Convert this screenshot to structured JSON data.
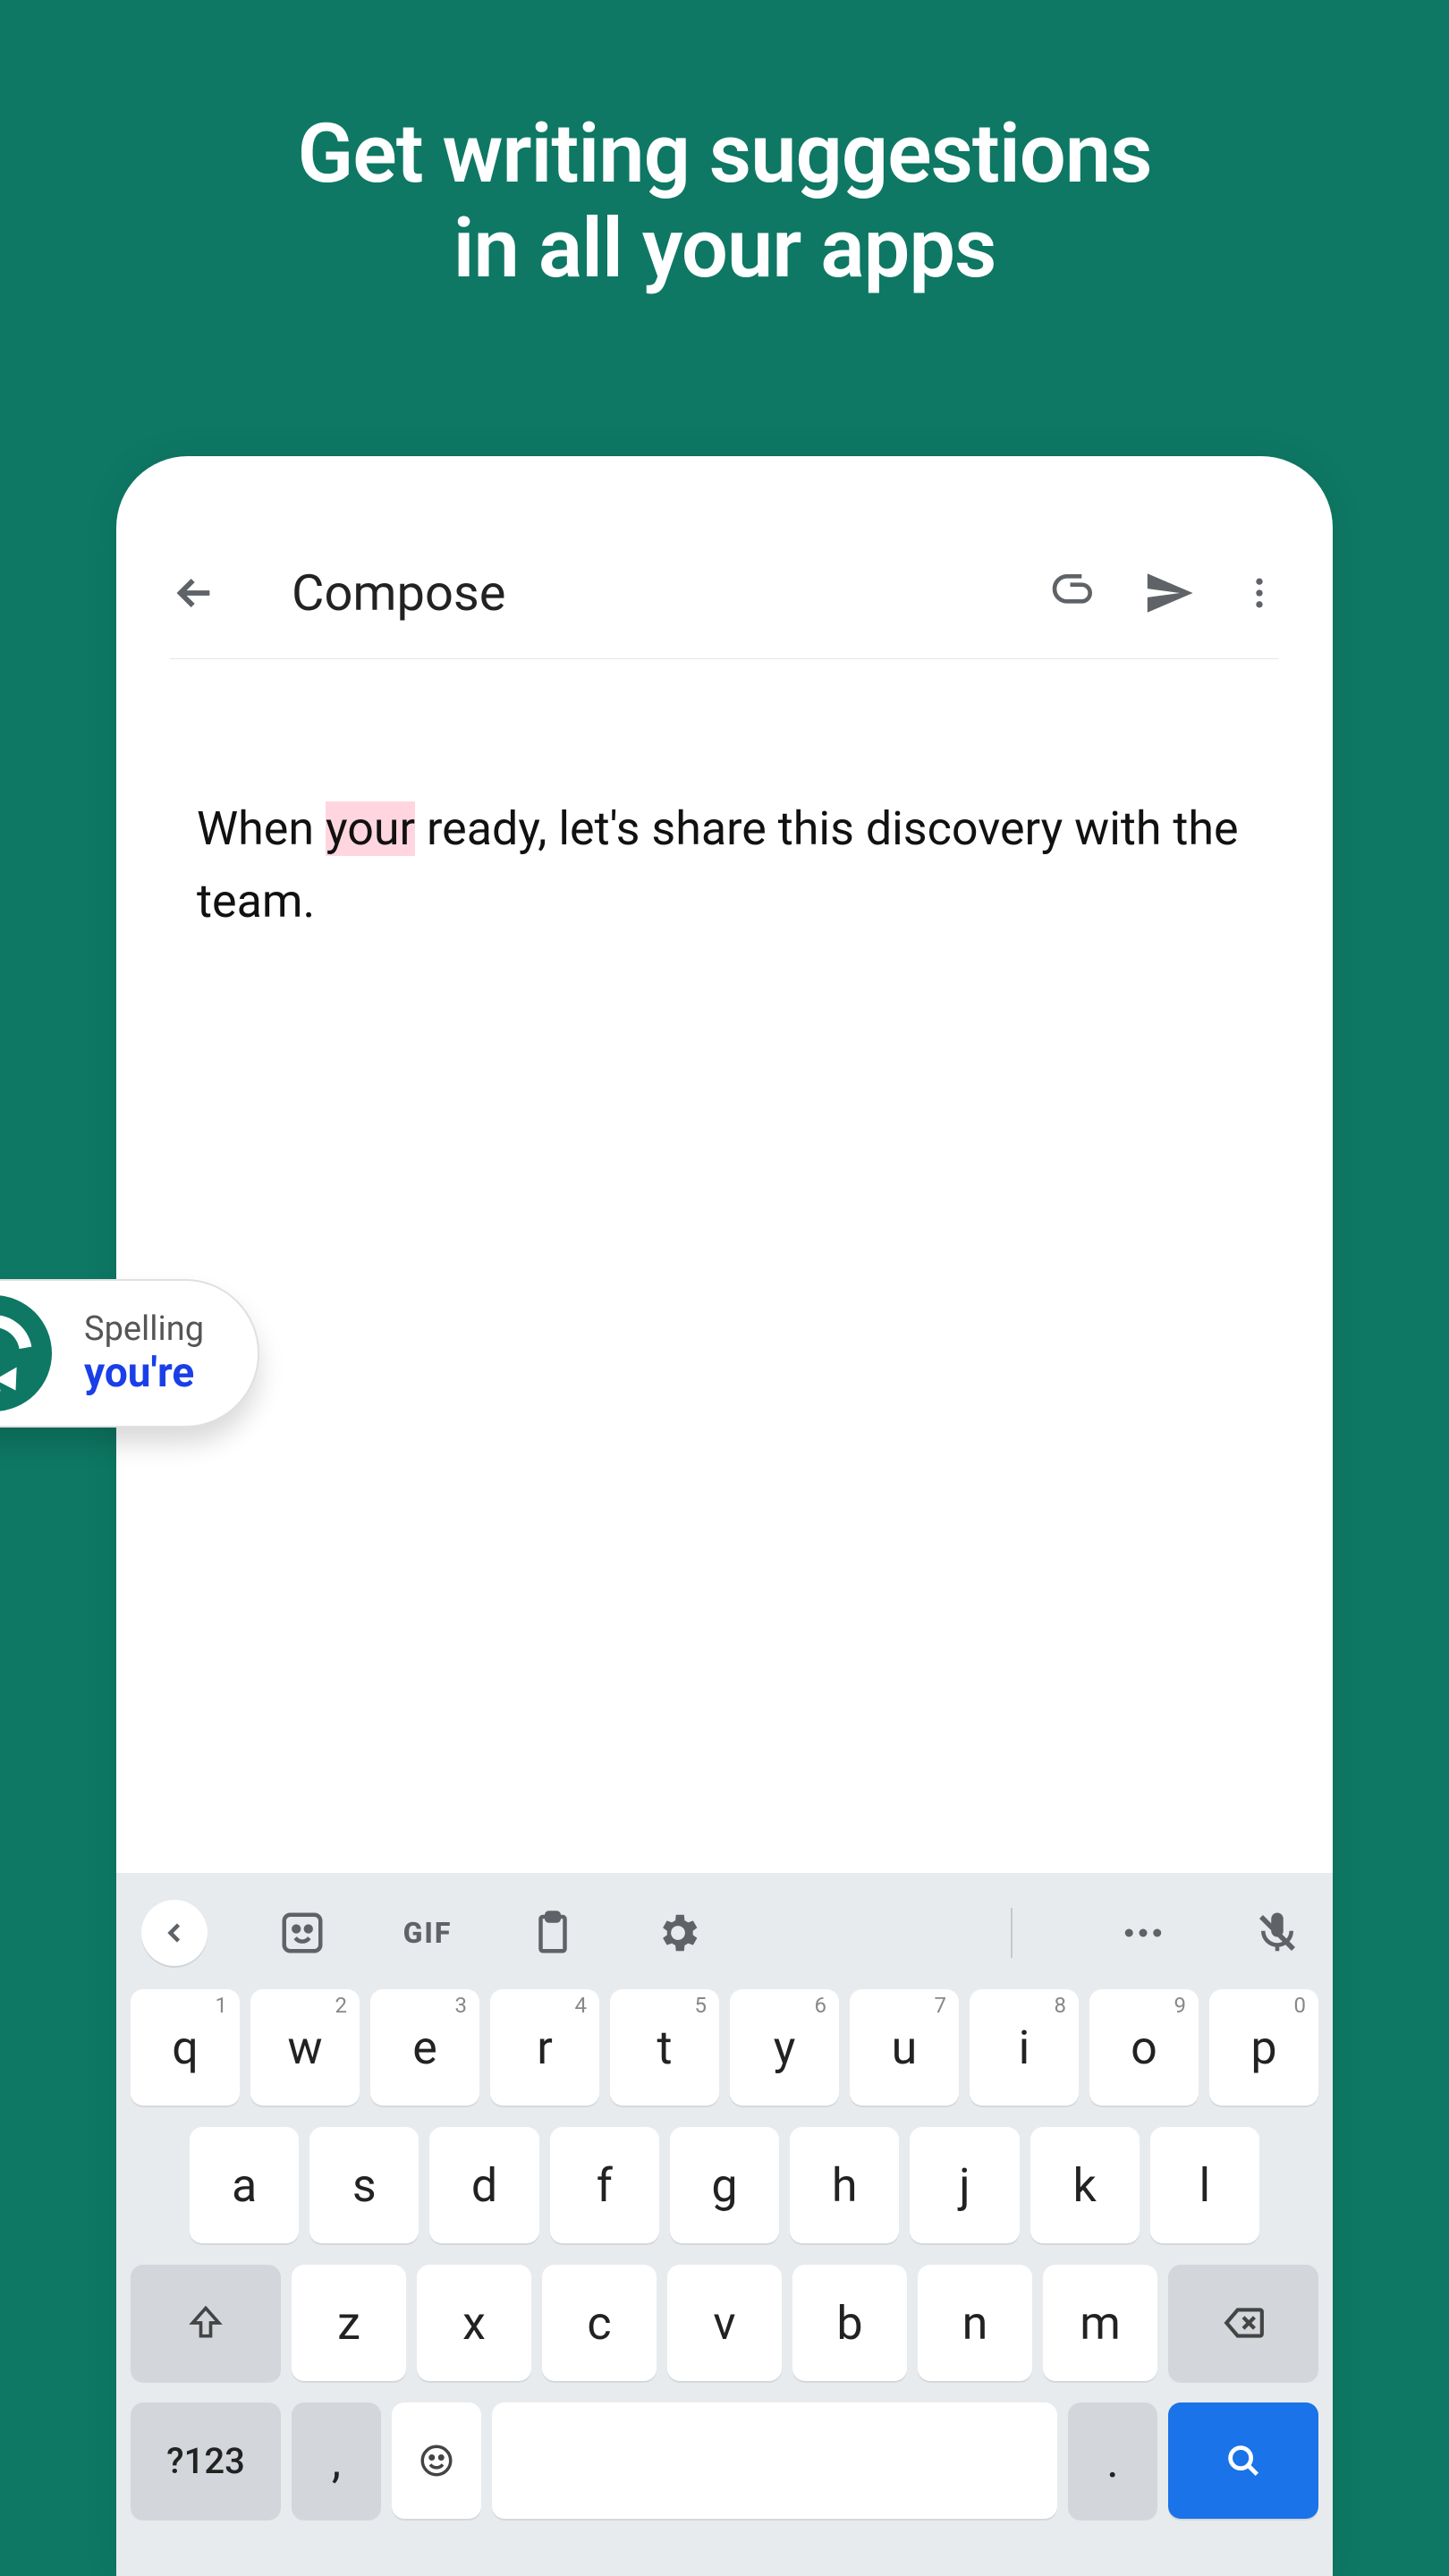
{
  "hero": {
    "line1": "Get writing suggestions",
    "line2": "in all your apps"
  },
  "appbar": {
    "title": "Compose"
  },
  "compose": {
    "before": "When ",
    "highlighted": "your",
    "after": " ready, let's share this discovery with the team."
  },
  "suggestion": {
    "label": "Spelling",
    "correction": "you're"
  },
  "keyboard": {
    "toolbar": {
      "gif_label": "GIF"
    },
    "row1": [
      {
        "k": "q",
        "n": "1"
      },
      {
        "k": "w",
        "n": "2"
      },
      {
        "k": "e",
        "n": "3"
      },
      {
        "k": "r",
        "n": "4"
      },
      {
        "k": "t",
        "n": "5"
      },
      {
        "k": "y",
        "n": "6"
      },
      {
        "k": "u",
        "n": "7"
      },
      {
        "k": "i",
        "n": "8"
      },
      {
        "k": "o",
        "n": "9"
      },
      {
        "k": "p",
        "n": "0"
      }
    ],
    "row2": [
      "a",
      "s",
      "d",
      "f",
      "g",
      "h",
      "j",
      "k",
      "l"
    ],
    "row3": [
      "z",
      "x",
      "c",
      "v",
      "b",
      "n",
      "m"
    ],
    "num_key": "?123",
    "comma": ",",
    "period": "."
  }
}
